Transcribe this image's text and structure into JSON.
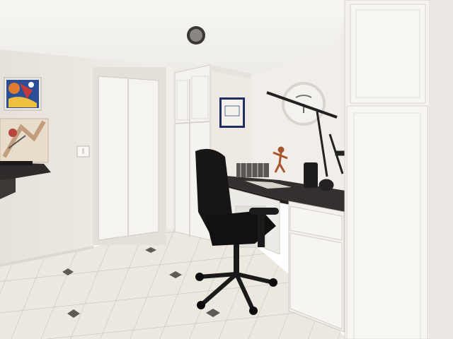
{
  "scene": {
    "colors": {
      "ceiling": "#f3f1ee",
      "wall_left": "#ebe7e1",
      "wall_center": "#f1ece6",
      "wall_right": "#eeeae6",
      "floor_tile": "#ece8e0",
      "grout": "#cfc9bf",
      "accent_tile": "#5f5a56",
      "cabinet_white": "#f4f3ef",
      "cabinet_shade": "#dcd9d3",
      "counter_granite": "#35302f",
      "chair_black": "#161616",
      "closet_door": "#f6f4f0",
      "art_blue": "#2b4f96",
      "art_orange": "#e07a2e",
      "art_red": "#c6383a"
    },
    "objects": [
      "ceiling-light",
      "bifold-closet-door",
      "abstract-painting",
      "framed-sculpture-art",
      "floating-wall-shelf",
      "light-switch",
      "tall-pantry-cabinet",
      "framed-certificate",
      "round-wall-clock",
      "built-in-desk",
      "granite-countertop",
      "desk-lamp",
      "file-organizer",
      "figurine",
      "desk-speaker",
      "office-chair",
      "tall-storage-cabinet",
      "tile-floor"
    ]
  }
}
